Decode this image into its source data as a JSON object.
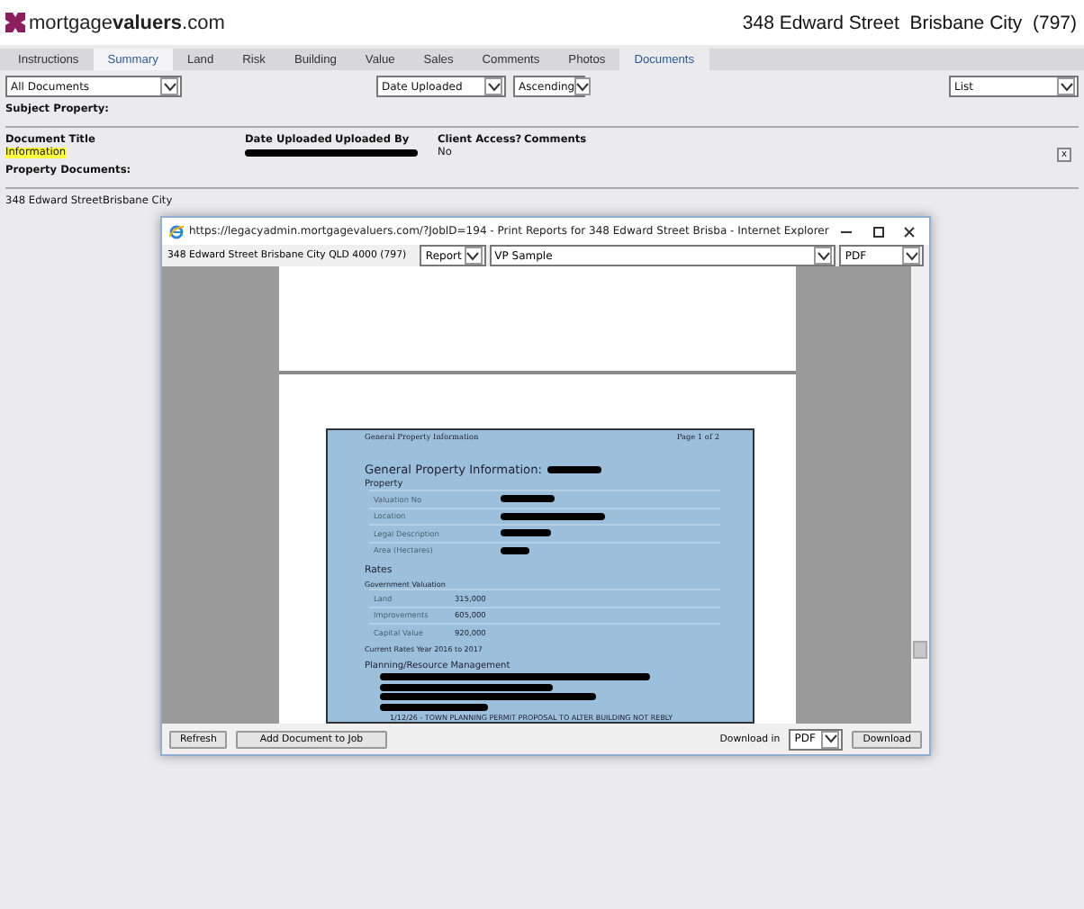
{
  "header": {
    "logo_plain": "mortgage",
    "logo_bold": "valuers",
    "logo_suffix": ".com",
    "property": "348 Edward Street  Brisbane City  (797)"
  },
  "tabs": [
    {
      "label": "Instructions",
      "selected": false
    },
    {
      "label": "Summary",
      "selected": false,
      "hovered": true
    },
    {
      "label": "Land",
      "selected": false
    },
    {
      "label": "Risk",
      "selected": false
    },
    {
      "label": "Building",
      "selected": false
    },
    {
      "label": "Value",
      "selected": false
    },
    {
      "label": "Sales",
      "selected": false
    },
    {
      "label": "Comments",
      "selected": false
    },
    {
      "label": "Photos",
      "selected": false
    },
    {
      "label": "Documents",
      "selected": true
    }
  ],
  "filters": {
    "document_type": "All Documents",
    "sort_by": "Date Uploaded",
    "order": "Ascending",
    "view": "List"
  },
  "subject_property_label": "Subject Property:",
  "documents_table": {
    "columns": [
      "Document Title",
      "Date Uploaded",
      "Uploaded By",
      "Client Access?",
      "Comments"
    ],
    "rows": [
      {
        "title": "Information",
        "highlighted": true,
        "client_access": "No",
        "delete": "x"
      }
    ]
  },
  "property_documents_label": "Property Documents:",
  "property_name": "348 Edward StreetBrisbane City",
  "popup": {
    "title": "https://legacyadmin.mortgagevaluers.com/?JobID=194 - Print Reports for 348 Edward Street Brisba - Internet Explorer",
    "address": "348 Edward Street Brisbane City QLD 4000 (797)",
    "report_type": "Report",
    "template": "VP Sample",
    "format": "PDF",
    "report": {
      "header_left": "General Property Information",
      "header_right": "Page 1 of 2",
      "heading": "General Property Information:",
      "property_section": "Property",
      "property_rows": [
        "Valuation No",
        "Location",
        "Legal Description",
        "Area (Hectares)"
      ],
      "rates_section": "Rates",
      "valuation_label": "Government Valuation",
      "rates_rows": [
        {
          "label": "Land",
          "value": "315,000"
        },
        {
          "label": "Improvements",
          "value": "605,000"
        },
        {
          "label": "Capital Value",
          "value": "920,000"
        }
      ],
      "rates_year": "Current Rates Year 2016 to 2017",
      "planning_section": "Planning/Resource Management",
      "planning_text": "1/12/26 - TOWN PLANNING PERMIT PROPOSAL TO ALTER BUILDING NOT REBLY"
    },
    "buttons": [
      "Refresh",
      "Add Document to Job"
    ],
    "download_label": "Download in",
    "download_format": "PDF",
    "download_button": "Download"
  }
}
